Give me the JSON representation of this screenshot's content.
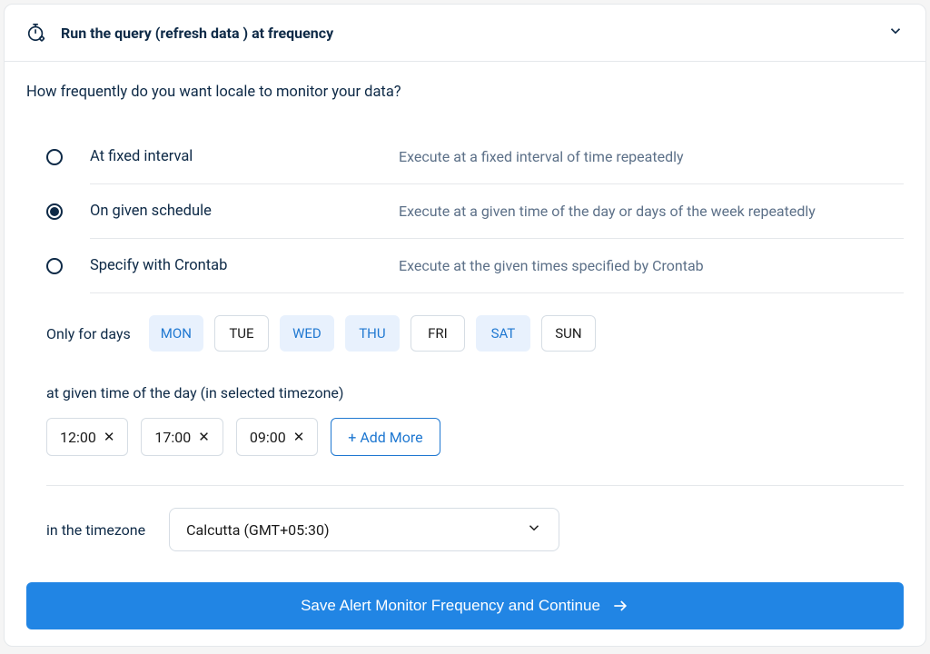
{
  "header": {
    "title": "Run the query (refresh data ) at frequency"
  },
  "question": "How frequently do you want locale to monitor your data?",
  "options": [
    {
      "label": "At fixed interval",
      "desc": "Execute at a fixed interval of time repeatedly",
      "selected": false
    },
    {
      "label": "On given schedule",
      "desc": "Execute at a given time of the day or days of the week repeatedly",
      "selected": true
    },
    {
      "label": "Specify with Crontab",
      "desc": "Execute at the given times specified by Crontab",
      "selected": false
    }
  ],
  "days": {
    "label": "Only for days",
    "items": [
      {
        "code": "MON",
        "selected": true
      },
      {
        "code": "TUE",
        "selected": false
      },
      {
        "code": "WED",
        "selected": true
      },
      {
        "code": "THU",
        "selected": true
      },
      {
        "code": "FRI",
        "selected": false
      },
      {
        "code": "SAT",
        "selected": true
      },
      {
        "code": "SUN",
        "selected": false
      }
    ]
  },
  "times": {
    "label": "at given time of the day (in selected timezone)",
    "items": [
      "12:00",
      "17:00",
      "09:00"
    ],
    "add_more": "+ Add More"
  },
  "timezone": {
    "label": "in the timezone",
    "value": "Calcutta (GMT+05:30)"
  },
  "footer": {
    "button": "Save Alert Monitor Frequency and Continue"
  }
}
